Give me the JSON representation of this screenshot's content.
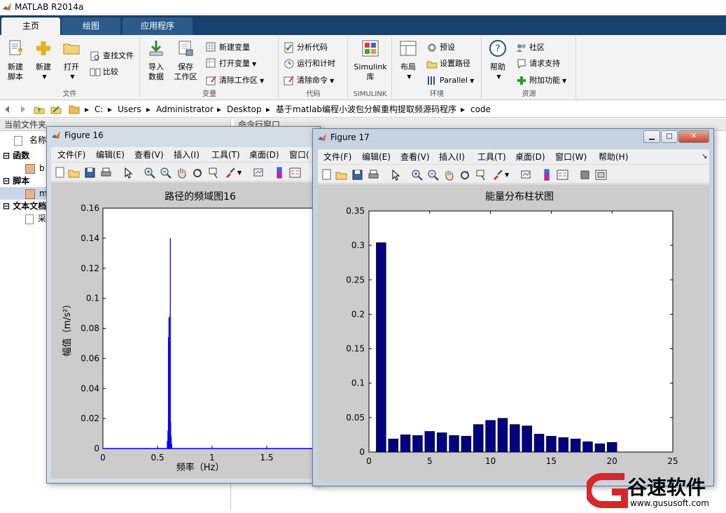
{
  "window": {
    "title": "MATLAB R2014a"
  },
  "tabs": [
    "主页",
    "绘图",
    "应用程序"
  ],
  "ribbon": {
    "file": {
      "label": "文件",
      "new_script": "新建\n脚本",
      "new": "新建",
      "open": "打开",
      "find_files": "查找文件",
      "compare": "比较"
    },
    "variable": {
      "label": "变量",
      "import": "导入\n数据",
      "save_ws": "保存\n工作区",
      "new_var": "新建变量",
      "open_var": "打开变量",
      "clear_ws": "清除工作区"
    },
    "code": {
      "label": "代码",
      "analyze": "分析代码",
      "run_time": "运行和计时",
      "clear_cmd": "清除命令"
    },
    "simulink": {
      "label": "SIMULINK",
      "lib": "Simulink\n库"
    },
    "env": {
      "label": "环境",
      "layout": "布局",
      "prefs": "预设",
      "set_path": "设置路径",
      "parallel": "Parallel"
    },
    "resources": {
      "label": "资源",
      "help": "帮助",
      "community": "社区",
      "support": "请求支持",
      "addons": "附加功能"
    }
  },
  "address": [
    "C:",
    "Users",
    "Administrator",
    "Desktop",
    "基于matlab编程小波包分解重构提取频源码程序",
    "code"
  ],
  "left_panel": {
    "title": "当前文件夹",
    "col_name": "名称",
    "groups": [
      {
        "label": "函数",
        "items": [
          "b"
        ]
      },
      {
        "label": "脚本",
        "items": [
          "m"
        ]
      },
      {
        "label": "文本文档",
        "items": [
          "采"
        ]
      }
    ]
  },
  "cmd_panel": {
    "title": "命令行窗口"
  },
  "fig16": {
    "title": "Figure 16",
    "menu": [
      "文件(F)",
      "编辑(E)",
      "查看(V)",
      "插入(I)",
      "工具(T)",
      "桌面(D)",
      "窗口("
    ],
    "chart_data": {
      "type": "line",
      "title": "路径的频域图16",
      "xlabel": "频率（Hz）",
      "ylabel": "幅值（m/s²）",
      "xlim": [
        0,
        2
      ],
      "ylim": [
        0,
        0.16
      ],
      "xticks": [
        "0",
        "0.5",
        "1",
        "1.5"
      ],
      "yticks": [
        "0",
        "0.02",
        "0.04",
        "0.06",
        "0.08",
        "0.1",
        "0.12",
        "0.14",
        "0.16"
      ],
      "spikes": [
        {
          "x": 0.59,
          "y": 0.005
        },
        {
          "x": 0.595,
          "y": 0.012
        },
        {
          "x": 0.6,
          "y": 0.074
        },
        {
          "x": 0.605,
          "y": 0.087
        },
        {
          "x": 0.61,
          "y": 0.088
        },
        {
          "x": 0.613,
          "y": 0.03
        },
        {
          "x": 0.617,
          "y": 0.14
        },
        {
          "x": 0.62,
          "y": 0.018
        },
        {
          "x": 0.625,
          "y": 0.008
        },
        {
          "x": 0.63,
          "y": 0.003
        }
      ],
      "color": "#0000ff"
    }
  },
  "fig17": {
    "title": "Figure 17",
    "menu": [
      "文件(F)",
      "编辑(E)",
      "查看(V)",
      "插入(I)",
      "工具(T)",
      "桌面(D)",
      "窗口(W)",
      "帮助(H)"
    ],
    "chart_data": {
      "type": "bar",
      "title": "能量分布柱状图",
      "xlim": [
        0,
        25
      ],
      "ylim": [
        0,
        0.35
      ],
      "xticks": [
        "0",
        "5",
        "10",
        "15",
        "20",
        "25"
      ],
      "yticks": [
        "0",
        "0.05",
        "0.1",
        "0.15",
        "0.2",
        "0.25",
        "0.3",
        "0.35"
      ],
      "x": [
        1,
        2,
        3,
        4,
        5,
        6,
        7,
        8,
        9,
        10,
        11,
        12,
        13,
        14,
        15,
        16,
        17,
        18,
        19,
        20
      ],
      "values": [
        0.304,
        0.019,
        0.025,
        0.024,
        0.03,
        0.028,
        0.024,
        0.023,
        0.04,
        0.046,
        0.049,
        0.04,
        0.038,
        0.026,
        0.023,
        0.021,
        0.019,
        0.015,
        0.012,
        0.014
      ],
      "color": "#000080"
    }
  },
  "watermark": {
    "name": "谷速软件",
    "url": "www.gususoft.com"
  }
}
